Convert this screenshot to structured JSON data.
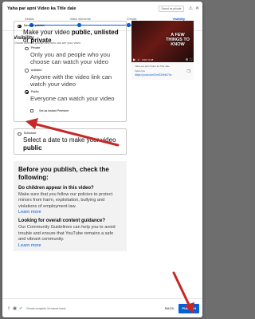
{
  "header": {
    "title": "Yaha par apni Video ka Title dale",
    "saved_status": "Saved as private",
    "icons": [
      "alert-icon",
      "close-icon"
    ]
  },
  "stepper": {
    "steps": [
      "Details",
      "Video elements",
      "Checks",
      "Visibility"
    ],
    "active_index": 3
  },
  "visibility": {
    "title": "Visibility",
    "subtitle": "Choose when to publish and who can see your video",
    "save_or_publish_label": "Save or publish",
    "save_or_publish_desc_prefix": "Make your video ",
    "save_or_publish_desc_bold": "public, unlisted",
    "save_or_publish_desc_mid": " or ",
    "save_or_publish_desc_bold2": "private",
    "private_label": "Private",
    "private_desc": "Only you and people who you choose can watch your video",
    "unlisted_label": "Unlisted",
    "unlisted_desc": "Anyone with the video link can watch your video",
    "public_label": "Public",
    "public_desc": "Everyone can watch your video",
    "premiere_label": "Set as instant Premiere",
    "selected_option": "Public",
    "schedule_label": "Schedule",
    "schedule_desc_prefix": "Select a date to make your video ",
    "schedule_desc_bold": "public"
  },
  "info_panel": {
    "title": "Before you publish, check the following:",
    "q1_title": "Do children appear in this video?",
    "q1_text": "Make sure that you follow our policies to protect minors from harm, exploitation, bullying and violations of employment law.",
    "q1_link": "Learn more",
    "q2_title": "Looking for overall content guidance?",
    "q2_text": "Our Community Guidelines can help you to avoid trouble and ensure that YouTube remains a safe and vibrant community.",
    "q2_link": "Learn more"
  },
  "video_card": {
    "thumb_text": "A FEW THINGS TO KNOW",
    "time": "0:00 / 0:38",
    "link_label": "Video link",
    "filename": "Yaha par apni Video ka Title dale",
    "url": "https://youtu.be/f2mE3h9kOTw"
  },
  "footer": {
    "status": "Checks complete. No issues found.",
    "back_label": "BACK",
    "publish_label": "PUBLISH"
  },
  "colors": {
    "accent": "#065fd4",
    "annotation_arrow": "#c62828"
  }
}
